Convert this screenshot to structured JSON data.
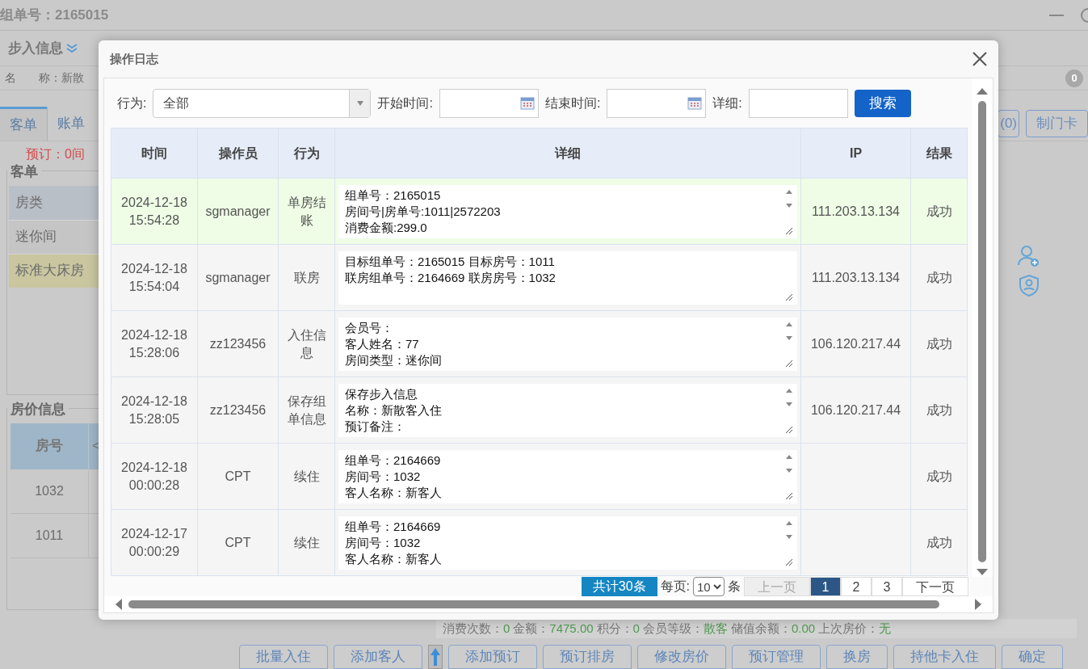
{
  "app": {
    "title": "组单号：2165015",
    "walkin": {
      "heading": "步入信息",
      "name_label": "名　　称：",
      "name_value": "新散"
    },
    "badge": "0",
    "tabs": [
      {
        "label": "客单",
        "selected": true
      },
      {
        "label": "账单",
        "selected": false
      }
    ],
    "reservation": "预订：0间",
    "top_buttons": [
      "(0)",
      "制门卡"
    ],
    "guest_panel": {
      "title": "客单",
      "header": "房类",
      "rows": [
        {
          "label": "迷你间",
          "selected": false
        },
        {
          "label": "标准大床房",
          "selected": true
        }
      ]
    },
    "price_panel": {
      "title": "房价信息",
      "columns": [
        "房号",
        "<"
      ],
      "rows": [
        "1032",
        "1011"
      ]
    },
    "member_stats": [
      {
        "label": "消费次数：",
        "value": "0"
      },
      {
        "label": "金额：",
        "value": "7475.00"
      },
      {
        "label": "积分：",
        "value": "0"
      },
      {
        "label": "会员等级：",
        "value": "散客"
      },
      {
        "label": "储值余额：",
        "value": "0.00"
      },
      {
        "label": "上次房价：",
        "value": "无"
      }
    ],
    "buttons": [
      {
        "kind": "text",
        "label": "批量入住"
      },
      {
        "kind": "text",
        "label": "添加客人"
      },
      {
        "kind": "icon"
      },
      {
        "kind": "text",
        "label": "添加预订"
      },
      {
        "kind": "text",
        "label": "预订排房"
      },
      {
        "kind": "text",
        "label": "修改房价"
      },
      {
        "kind": "text",
        "label": "预订管理"
      },
      {
        "kind": "text",
        "label": "换房"
      },
      {
        "kind": "text",
        "label": "持他卡入住"
      },
      {
        "kind": "text",
        "label": "确定"
      }
    ]
  },
  "dialog": {
    "title": "操作日志",
    "filters": {
      "action_label": "行为:",
      "action_value": "全部",
      "start_label": "开始时间:",
      "end_label": "结束时间:",
      "detail_label": "详细:",
      "search_button": "搜索"
    },
    "columns": [
      "时间",
      "操作员",
      "行为",
      "详细",
      "IP",
      "结果"
    ],
    "rows": [
      {
        "date": "2024-12-18",
        "time": "15:54:28",
        "operator": "sgmanager",
        "action": "单房结账",
        "detail": [
          "组单号：2165015",
          "房间号|房单号:1011|2572203",
          "消费金额:299.0"
        ],
        "scrollable": true,
        "ip": "111.203.13.134",
        "result": "成功",
        "selected": true
      },
      {
        "date": "2024-12-18",
        "time": "15:54:04",
        "operator": "sgmanager",
        "action": "联房",
        "detail": [
          "目标组单号：2165015 目标房号：1011",
          "联房组单号：2164669 联房房号：1032"
        ],
        "scrollable": false,
        "ip": "111.203.13.134",
        "result": "成功",
        "selected": false
      },
      {
        "date": "2024-12-18",
        "time": "15:28:06",
        "operator": "zz123456",
        "action": "入住信息",
        "detail": [
          "会员号：",
          "客人姓名：77",
          "房间类型：迷你间"
        ],
        "scrollable": true,
        "ip": "106.120.217.44",
        "result": "成功",
        "selected": false
      },
      {
        "date": "2024-12-18",
        "time": "15:28:05",
        "operator": "zz123456",
        "action": "保存组单信息",
        "detail": [
          "保存步入信息",
          "名称：新散客入住",
          "预订备注："
        ],
        "scrollable": true,
        "ip": "106.120.217.44",
        "result": "成功",
        "selected": false
      },
      {
        "date": "2024-12-18",
        "time": "00:00:28",
        "operator": "CPT",
        "action": "续住",
        "detail": [
          "组单号：2164669",
          "房间号：1032",
          "客人名称：新客人"
        ],
        "scrollable": true,
        "result": "成功",
        "selected": false
      },
      {
        "date": "2024-12-17",
        "time": "00:00:29",
        "operator": "CPT",
        "action": "续住",
        "detail": [
          "组单号：2164669",
          "房间号：1032",
          "客人名称：新客人"
        ],
        "scrollable": true,
        "result": "成功",
        "selected": false
      }
    ],
    "pagination": {
      "total": "共计30条",
      "per_page_label": "每页:",
      "per_page_value": "10",
      "per_page_unit": "条",
      "prev": "上一页",
      "prev_disabled": true,
      "pages": [
        {
          "label": "1",
          "selected": true
        },
        {
          "label": "2",
          "selected": false
        },
        {
          "label": "3",
          "selected": false
        }
      ],
      "next": "下一页"
    }
  }
}
